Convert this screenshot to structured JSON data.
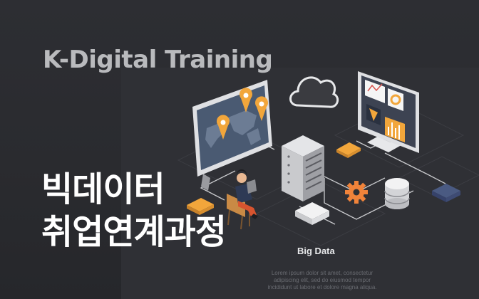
{
  "banner": {
    "eyebrow": "K-Digital Training",
    "title_line1": "빅데이터",
    "title_line2": "취업연계과정"
  },
  "illustration": {
    "label": "Big Data",
    "caption_lines": [
      "Lorem ipsum dolor sit amet, consectetur",
      "adipiscing elit, sed do eiusmod tempor",
      "incididunt ut labore et dolore magna aliqua."
    ],
    "icons": [
      "world-map-monitor-icon",
      "cloud-icon",
      "analytics-monitor-icon",
      "server-rack-icon",
      "database-icon",
      "gear-icon",
      "person-with-tablet-icon"
    ]
  },
  "colors": {
    "background": "#2a2b2f",
    "accent": "#f2a63b",
    "title": "#ffffff",
    "eyebrow": "#b9babd"
  }
}
